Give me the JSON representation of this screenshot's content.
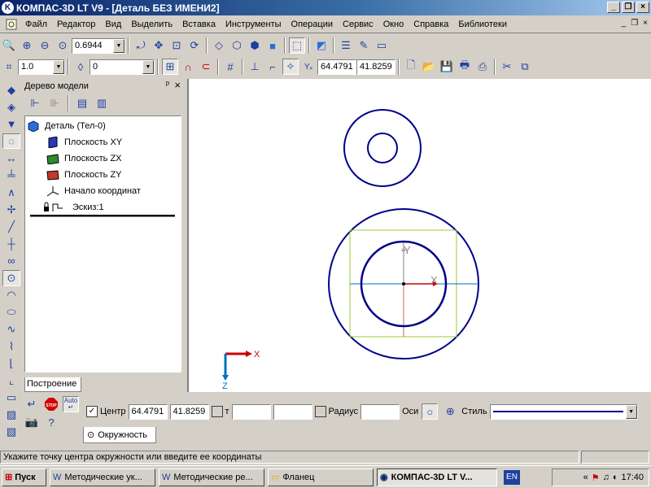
{
  "title": {
    "text": "КОМПАС-3D LT V9 - [Деталь БЕЗ ИМЕНИ2]",
    "minimize": "_",
    "restore": "❐",
    "close": "×"
  },
  "menu": [
    {
      "label": "Файл"
    },
    {
      "label": "Редактор"
    },
    {
      "label": "Вид"
    },
    {
      "label": "Выделить"
    },
    {
      "label": "Вставка"
    },
    {
      "label": "Инструменты"
    },
    {
      "label": "Операции"
    },
    {
      "label": "Сервис"
    },
    {
      "label": "Окно"
    },
    {
      "label": "Справка"
    },
    {
      "label": "Библиотеки"
    }
  ],
  "toolbar1": {
    "zoom_value": "0.6944"
  },
  "toolbar2": {
    "step_value": "1.0",
    "layer_value": "0",
    "coord_x": "64.4791",
    "coord_y": "41.8259"
  },
  "tree": {
    "title": "Дерево модели",
    "pin": "ᵖ",
    "close": "×",
    "items": [
      {
        "label": "Деталь (Тел-0)"
      },
      {
        "label": "Плоскость XY"
      },
      {
        "label": "Плоскость ZX"
      },
      {
        "label": "Плоскость ZY"
      },
      {
        "label": "Начало координат"
      },
      {
        "label": "Эскиз:1"
      }
    ],
    "tab": "Построение"
  },
  "canvas": {
    "origin_x_label": "X",
    "origin_z_label": "Z",
    "axis_y_label": "Y",
    "axis_x_label": "X",
    "colors": {
      "circle": "#00008b",
      "rect": "#9acd32",
      "axis_red": "#cc0000",
      "axis_blue": "#0070c0"
    }
  },
  "props": {
    "center_label": "Центр",
    "center_x": "64.4791",
    "center_y": "41.8259",
    "t_label": "т",
    "radius_label": "Радиус",
    "radius_value": "",
    "axes_label": "Оси",
    "style_label": "Стиль",
    "tab_label": "Окружность",
    "stop_label": "STOP",
    "auto_label": "Auto"
  },
  "status": {
    "text": "Укажите точку центра окружности или введите ее координаты"
  },
  "taskbar": {
    "start": "Пуск",
    "tasks": [
      {
        "label": "Методические ук..."
      },
      {
        "label": "Методические ре..."
      },
      {
        "label": "Фланец"
      },
      {
        "label": "КОМПАС-3D LT V..."
      }
    ],
    "lang": "EN",
    "time": "17:40",
    "chevron": "«"
  }
}
